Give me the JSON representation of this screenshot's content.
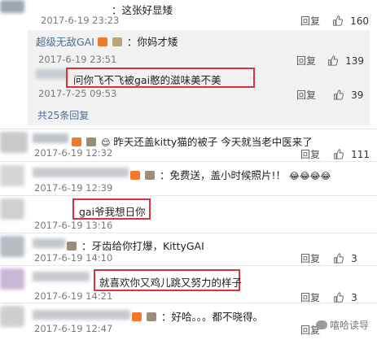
{
  "comments": [
    {
      "text": "：这张好显矮",
      "date": "2017-6-19 23:23",
      "reply": "回复",
      "likes": "160"
    },
    {
      "text": "昨天还盖kitty猫的被子 今天就当老中医来了",
      "date": "2017-6-19 12:32",
      "reply": "回复",
      "likes": "111"
    },
    {
      "text": "：免费送，盖小时候照片!！",
      "emoji": "😂😂😂😂",
      "date": "2017-6-19 12:39"
    },
    {
      "text": "gai爷我想日你",
      "date": "2017-6-19 13:16"
    },
    {
      "text": "：牙齿给你打爆，KittyGAI",
      "date": "2017-6-19 14:10",
      "reply": "回复",
      "likes": "3"
    },
    {
      "text": "就喜欢你又鸡儿跳又努力的样子",
      "date": "2017-6-19 14:21",
      "reply": "回复",
      "likes": "3"
    },
    {
      "text": "：好哈。。。都不晓得。",
      "date": "2017-6-19 12:47",
      "reply": "回复"
    }
  ],
  "replies": [
    {
      "username": "超级无敌GAI",
      "text": "：你妈才矮",
      "date": "2017-6-19 23:51",
      "reply": "回复",
      "likes": "139"
    },
    {
      "text": "问你飞不飞被gai憨的滋味美不美",
      "date": "2017-7-25 09:53",
      "reply": "回复",
      "likes": "39"
    }
  ],
  "reply_total": "共25条回复",
  "watermark": "嘻哈读导",
  "colors": {
    "highlight": "#d9343a",
    "username": "#4a6d9b",
    "panel": "#f2f2f2"
  }
}
